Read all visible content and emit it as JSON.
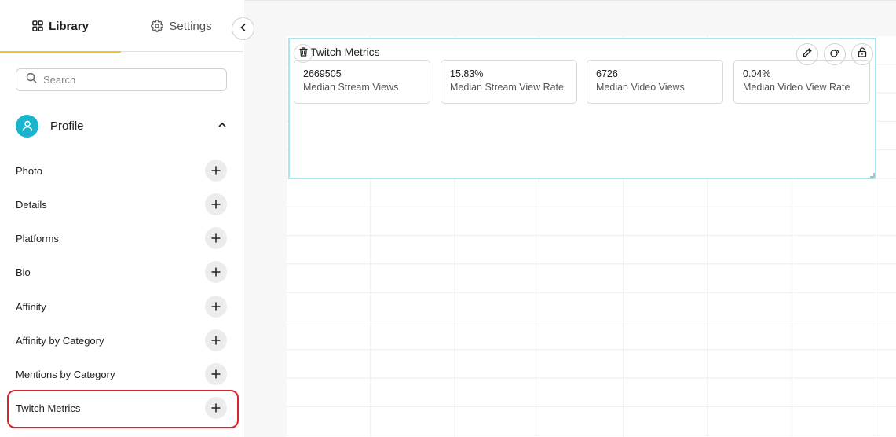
{
  "tabs": [
    {
      "label": "Library",
      "icon": "grid-icon",
      "active": true
    },
    {
      "label": "Settings",
      "icon": "gear-icon",
      "active": false
    }
  ],
  "search": {
    "placeholder": "Search",
    "value": ""
  },
  "section": {
    "title": "Profile",
    "icon": "user-icon",
    "expanded": true
  },
  "items": [
    {
      "label": "Photo"
    },
    {
      "label": "Details"
    },
    {
      "label": "Platforms"
    },
    {
      "label": "Bio"
    },
    {
      "label": "Affinity"
    },
    {
      "label": "Affinity by Category"
    },
    {
      "label": "Mentions by Category"
    },
    {
      "label": "Twitch Metrics"
    }
  ],
  "widget": {
    "title": "Twitch Metrics",
    "metrics": [
      {
        "value": "2669505",
        "label": "Median Stream Views"
      },
      {
        "value": "15.83%",
        "label": "Median Stream View Rate"
      },
      {
        "value": "6726",
        "label": "Median Video Views"
      },
      {
        "value": "0.04%",
        "label": "Median Video View Rate"
      }
    ]
  },
  "colors": {
    "accent": "#f2c230",
    "avatar": "#19b5cf",
    "highlight": "#d8242b",
    "widget_border": "#a9e7ee"
  }
}
